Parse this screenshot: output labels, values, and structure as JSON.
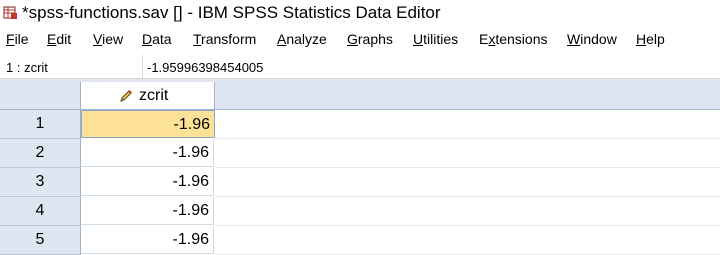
{
  "window": {
    "title": "*spss-functions.sav [] - IBM SPSS Statistics Data Editor"
  },
  "menu": [
    {
      "label": "File",
      "accel": "F"
    },
    {
      "label": "Edit",
      "accel": "E"
    },
    {
      "label": "View",
      "accel": "V"
    },
    {
      "label": "Data",
      "accel": "D"
    },
    {
      "label": "Transform",
      "accel": "T"
    },
    {
      "label": "Analyze",
      "accel": "A"
    },
    {
      "label": "Graphs",
      "accel": "G"
    },
    {
      "label": "Utilities",
      "accel": "U"
    },
    {
      "label": "Extensions",
      "accel": "x"
    },
    {
      "label": "Window",
      "accel": "W"
    },
    {
      "label": "Help",
      "accel": "H"
    }
  ],
  "cell_editor": {
    "ref": "1 : zcrit",
    "value": "-1.95996398454005"
  },
  "grid": {
    "columns": [
      {
        "name": "zcrit",
        "icon": "pencil-icon"
      }
    ],
    "rows": [
      {
        "num": "1",
        "value": "-1.96",
        "selected": true
      },
      {
        "num": "2",
        "value": "-1.96"
      },
      {
        "num": "3",
        "value": "-1.96"
      },
      {
        "num": "4",
        "value": "-1.96"
      },
      {
        "num": "5",
        "value": "-1.96"
      }
    ],
    "selected_color": "#fde196",
    "header_color": "#dde6f1"
  }
}
